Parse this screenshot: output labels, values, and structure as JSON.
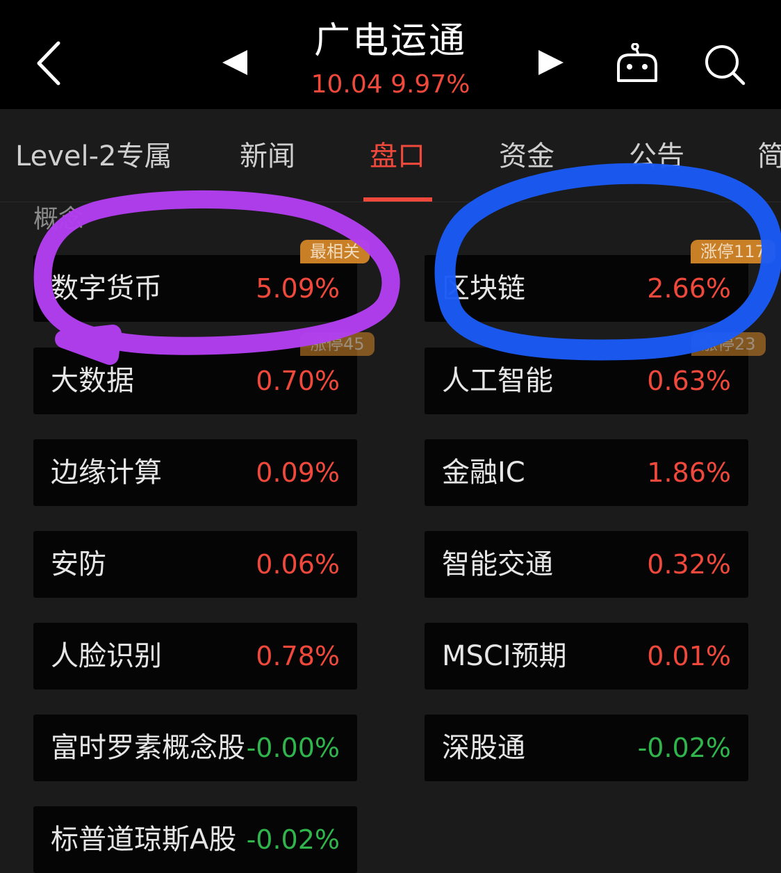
{
  "header": {
    "stock_name": "广电运通",
    "quote": "10.04 9.97%"
  },
  "tabs": [
    {
      "label": "Level-2专属"
    },
    {
      "label": "新闻"
    },
    {
      "label": "盘口"
    },
    {
      "label": "资金"
    },
    {
      "label": "公告"
    },
    {
      "label": "简"
    }
  ],
  "active_tab": "盘口",
  "section": {
    "label": "概念"
  },
  "concepts": [
    {
      "name": "数字货币",
      "pct": "5.09%",
      "badge": "最相关"
    },
    {
      "name": "区块链",
      "pct": "2.66%",
      "badge": "涨停117"
    },
    {
      "name": "大数据",
      "pct": "0.70%",
      "badge": "涨停45"
    },
    {
      "name": "人工智能",
      "pct": "0.63%",
      "badge": "涨停23"
    },
    {
      "name": "边缘计算",
      "pct": "0.09%"
    },
    {
      "name": "金融IC",
      "pct": "1.86%"
    },
    {
      "name": "安防",
      "pct": "0.06%"
    },
    {
      "name": "智能交通",
      "pct": "0.32%"
    },
    {
      "name": "人脸识别",
      "pct": "0.78%"
    },
    {
      "name": "MSCI预期",
      "pct": "0.01%"
    },
    {
      "name": "富时罗素概念股",
      "pct": "-0.00%"
    },
    {
      "name": "深股通",
      "pct": "-0.02%"
    },
    {
      "name": "标普道琼斯A股",
      "pct": "-0.02%"
    }
  ],
  "colors": {
    "up": "#f0493c",
    "down": "#2fb54c",
    "badge": "#c97f25",
    "annotation_purple": "#b23ff0",
    "annotation_blue": "#1b5bf5"
  },
  "icons": [
    "back-arrow-icon",
    "prev-triangle-icon",
    "next-triangle-icon",
    "robot-icon",
    "search-icon"
  ]
}
